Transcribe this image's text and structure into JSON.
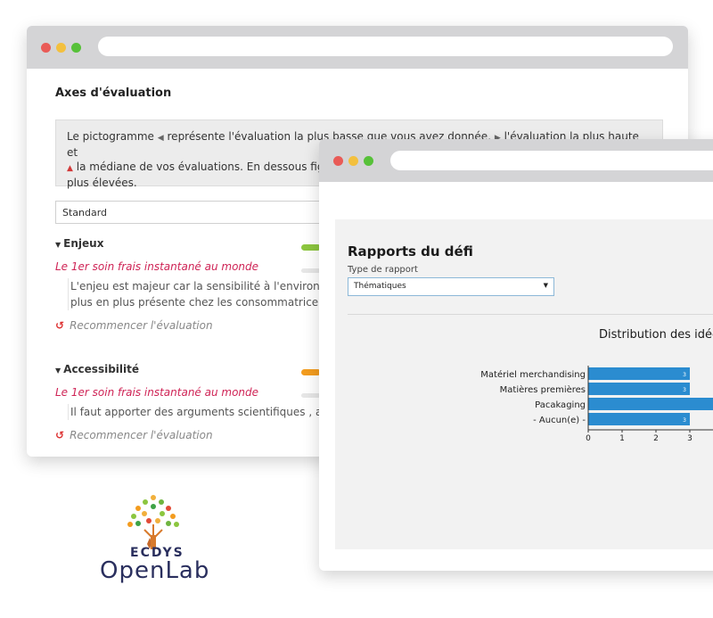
{
  "evaluation_window": {
    "title": "Axes d'évaluation",
    "info_text_1": "Le pictogramme",
    "info_text_2": "représente l'évaluation la plus basse que vous avez donnée,",
    "info_text_3": "l'évaluation la plus haute et",
    "info_text_4": "la médiane de vos évaluations. En dessous fig",
    "info_text_5": "plus élevées.",
    "profile_select": "Standard",
    "axes": [
      {
        "name": "Enjeux",
        "item": "Le 1er soin frais instantané au monde",
        "comment_line_1": "L'enjeu est majeur car la sensibilité à l'environn",
        "comment_line_2": "plus en plus présente chez les consommatrice",
        "restart": "Recommencer l'évaluation",
        "bar_color": "#8cc63f"
      },
      {
        "name": "Accessibilité",
        "item": "Le 1er soin frais instantané au monde",
        "comment_line_1": "Il faut apporter des arguments scientifiques , a",
        "restart": "Recommencer l'évaluation",
        "bar_color": "#f39c1f"
      }
    ]
  },
  "report_window": {
    "title": "Rapports du défi",
    "type_label": "Type de rapport",
    "type_value": "Thématiques",
    "chart_title": "Distribution des idées"
  },
  "chart_data": {
    "type": "bar",
    "orientation": "horizontal",
    "title": "Distribution des idées",
    "categories": [
      "Matériel merchandising",
      "Matières premières",
      "Pacakaging",
      "- Aucun(e) -"
    ],
    "values": [
      3,
      3,
      4,
      3
    ],
    "data_labels": [
      "3",
      "3",
      "",
      "3"
    ],
    "x_ticks": [
      "0",
      "1",
      "2",
      "3"
    ],
    "xlim": [
      0,
      4
    ],
    "bar_color": "#2b8cd0"
  },
  "logo": {
    "line1": "ECDYS",
    "line2": "OpenLab"
  }
}
